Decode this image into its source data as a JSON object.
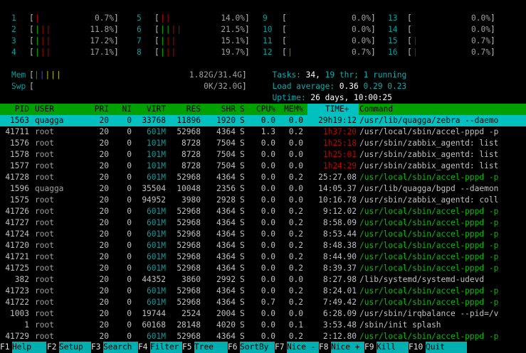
{
  "cpu_meters": [
    {
      "id": "1",
      "bar": "|",
      "pct": "0.7%"
    },
    {
      "id": "2",
      "bar": "|||",
      "pct": "11.8%"
    },
    {
      "id": "3",
      "bar": "|||",
      "pct": "17.2%"
    },
    {
      "id": "4",
      "bar": "|||",
      "pct": "17.1%"
    },
    {
      "id": "5",
      "bar": "||",
      "pct": "14.0%"
    },
    {
      "id": "6",
      "bar": "||||",
      "pct": "21.5%"
    },
    {
      "id": "7",
      "bar": "|||",
      "pct": "15.1%"
    },
    {
      "id": "8",
      "bar": "|||",
      "pct": "19.7%"
    },
    {
      "id": "9",
      "bar": "",
      "pct": "0.0%"
    },
    {
      "id": "10",
      "bar": "",
      "pct": "0.0%"
    },
    {
      "id": "11",
      "bar": "",
      "pct": "0.0%"
    },
    {
      "id": "12",
      "bar": "|",
      "pct": "0.7%"
    },
    {
      "id": "13",
      "bar": "",
      "pct": "0.0%"
    },
    {
      "id": "14",
      "bar": "",
      "pct": "0.0%"
    },
    {
      "id": "15",
      "bar": "|",
      "pct": "0.7%"
    },
    {
      "id": "16",
      "bar": "|",
      "pct": "0.7%"
    }
  ],
  "mem": {
    "label": "Mem",
    "bar": "|||||",
    "value": "1.82G/31.4G"
  },
  "swp": {
    "label": "Swp",
    "bar": "",
    "value": "0K/32.0G"
  },
  "tasks": {
    "label": "Tasks:",
    "count": "34,",
    "thr": "19",
    "thr_label": "thr;",
    "running": "1",
    "running_label": "running"
  },
  "load": {
    "label": "Load average:",
    "v1": "0.36",
    "v2": "0.29",
    "v3": "0.23"
  },
  "uptime": {
    "label": "Uptime:",
    "value": "26 days, 10:00:25"
  },
  "columns": {
    "pid": "PID",
    "user": "USER",
    "pri": "PRI",
    "ni": "NI",
    "virt": "VIRT",
    "res": "RES",
    "shr": "SHR",
    "s": "S",
    "cpu": "CPU%",
    "mem": "MEM%",
    "time": "TIME+",
    "command": "Command"
  },
  "processes": [
    {
      "pid": "1563",
      "user": "quagga",
      "pri": "20",
      "ni": "0",
      "virt": "33768",
      "res": "11896",
      "shr": "1920",
      "s": "S",
      "cpu": "0.0",
      "mem": "0.0",
      "time": "29h19:12",
      "command": "/usr/lib/quagga/zebra --daemo",
      "selected": true
    },
    {
      "pid": "41711",
      "user": "root",
      "pri": "20",
      "ni": "0",
      "virt": "601M",
      "res": "52968",
      "shr": "4364",
      "s": "S",
      "cpu": "1.3",
      "mem": "0.2",
      "time": "1h37:20",
      "command": "/usr/local/sbin/accel-pppd -p"
    },
    {
      "pid": "1576",
      "user": "root",
      "pri": "20",
      "ni": "0",
      "virt": "101M",
      "res": "8728",
      "shr": "7504",
      "s": "S",
      "cpu": "0.0",
      "mem": "0.0",
      "time": "1h25:18",
      "command": "/usr/sbin/zabbix_agentd: list"
    },
    {
      "pid": "1578",
      "user": "root",
      "pri": "20",
      "ni": "0",
      "virt": "101M",
      "res": "8728",
      "shr": "7504",
      "s": "S",
      "cpu": "0.0",
      "mem": "0.0",
      "time": "1h25:01",
      "command": "/usr/sbin/zabbix_agentd: list"
    },
    {
      "pid": "1577",
      "user": "root",
      "pri": "20",
      "ni": "0",
      "virt": "101M",
      "res": "8728",
      "shr": "7504",
      "s": "S",
      "cpu": "0.0",
      "mem": "0.0",
      "time": "1h24:29",
      "command": "/usr/sbin/zabbix_agentd: list"
    },
    {
      "pid": "41728",
      "user": "root",
      "pri": "20",
      "ni": "0",
      "virt": "601M",
      "res": "52968",
      "shr": "4364",
      "s": "S",
      "cpu": "0.0",
      "mem": "0.2",
      "time": "25:27.08",
      "command": "/usr/local/sbin/accel-pppd -p",
      "green": true
    },
    {
      "pid": "1596",
      "user": "quagga",
      "pri": "20",
      "ni": "0",
      "virt": "35504",
      "res": "10048",
      "shr": "2356",
      "s": "S",
      "cpu": "0.0",
      "mem": "0.0",
      "time": "14:05.37",
      "command": "/usr/lib/quagga/bgpd --daemon"
    },
    {
      "pid": "1575",
      "user": "root",
      "pri": "20",
      "ni": "0",
      "virt": "94952",
      "res": "3980",
      "shr": "2928",
      "s": "S",
      "cpu": "0.0",
      "mem": "0.0",
      "time": "10:16.78",
      "command": "/usr/sbin/zabbix_agentd: coll"
    },
    {
      "pid": "41726",
      "user": "root",
      "pri": "20",
      "ni": "0",
      "virt": "601M",
      "res": "52968",
      "shr": "4364",
      "s": "S",
      "cpu": "0.0",
      "mem": "0.2",
      "time": "9:12.02",
      "command": "/usr/local/sbin/accel-pppd -p",
      "green": true
    },
    {
      "pid": "41727",
      "user": "root",
      "pri": "20",
      "ni": "0",
      "virt": "601M",
      "res": "52968",
      "shr": "4364",
      "s": "S",
      "cpu": "0.0",
      "mem": "0.2",
      "time": "8:58.09",
      "command": "/usr/local/sbin/accel-pppd -p",
      "green": true
    },
    {
      "pid": "41724",
      "user": "root",
      "pri": "20",
      "ni": "0",
      "virt": "601M",
      "res": "52968",
      "shr": "4364",
      "s": "S",
      "cpu": "0.0",
      "mem": "0.2",
      "time": "8:53.44",
      "command": "/usr/local/sbin/accel-pppd -p",
      "green": true
    },
    {
      "pid": "41720",
      "user": "root",
      "pri": "20",
      "ni": "0",
      "virt": "601M",
      "res": "52968",
      "shr": "4364",
      "s": "S",
      "cpu": "0.0",
      "mem": "0.2",
      "time": "8:48.38",
      "command": "/usr/local/sbin/accel-pppd -p",
      "green": true
    },
    {
      "pid": "41721",
      "user": "root",
      "pri": "20",
      "ni": "0",
      "virt": "601M",
      "res": "52968",
      "shr": "4364",
      "s": "S",
      "cpu": "0.0",
      "mem": "0.2",
      "time": "8:44.90",
      "command": "/usr/local/sbin/accel-pppd -p",
      "green": true
    },
    {
      "pid": "41725",
      "user": "root",
      "pri": "20",
      "ni": "0",
      "virt": "601M",
      "res": "52968",
      "shr": "4364",
      "s": "S",
      "cpu": "0.0",
      "mem": "0.2",
      "time": "8:39.37",
      "command": "/usr/local/sbin/accel-pppd -p",
      "green": true
    },
    {
      "pid": "382",
      "user": "root",
      "pri": "20",
      "ni": "0",
      "virt": "44352",
      "res": "3860",
      "shr": "2992",
      "s": "S",
      "cpu": "0.0",
      "mem": "0.0",
      "time": "8:27.98",
      "command": "/lib/systemd/systemd-udevd"
    },
    {
      "pid": "41723",
      "user": "root",
      "pri": "20",
      "ni": "0",
      "virt": "601M",
      "res": "52968",
      "shr": "4364",
      "s": "S",
      "cpu": "0.0",
      "mem": "0.2",
      "time": "8:24.01",
      "command": "/usr/local/sbin/accel-pppd -p",
      "green": true
    },
    {
      "pid": "41722",
      "user": "root",
      "pri": "20",
      "ni": "0",
      "virt": "601M",
      "res": "52968",
      "shr": "4364",
      "s": "S",
      "cpu": "0.7",
      "mem": "0.2",
      "time": "7:49.42",
      "command": "/usr/local/sbin/accel-pppd -p",
      "green": true
    },
    {
      "pid": "1003",
      "user": "root",
      "pri": "20",
      "ni": "0",
      "virt": "19744",
      "res": "2524",
      "shr": "2004",
      "s": "S",
      "cpu": "0.0",
      "mem": "0.0",
      "time": "6:28.09",
      "command": "/usr/sbin/irqbalance --pid=/v"
    },
    {
      "pid": "1",
      "user": "root",
      "pri": "20",
      "ni": "0",
      "virt": "60168",
      "res": "28148",
      "shr": "4020",
      "s": "S",
      "cpu": "0.0",
      "mem": "0.1",
      "time": "3:53.48",
      "command": "/sbin/init splash"
    },
    {
      "pid": "41729",
      "user": "root",
      "pri": "20",
      "ni": "0",
      "virt": "601M",
      "res": "52968",
      "shr": "4364",
      "s": "S",
      "cpu": "0.0",
      "mem": "0.2",
      "time": "2:12.80",
      "command": "/usr/local/sbin/accel-pppd -p",
      "green": true
    }
  ],
  "footer": [
    {
      "key": "F1",
      "label": "Help"
    },
    {
      "key": "F2",
      "label": "Setup"
    },
    {
      "key": "F3",
      "label": "Search"
    },
    {
      "key": "F4",
      "label": "Filter"
    },
    {
      "key": "F5",
      "label": "Tree"
    },
    {
      "key": "F6",
      "label": "SortBy"
    },
    {
      "key": "F7",
      "label": "Nice -"
    },
    {
      "key": "F8",
      "label": "Nice +"
    },
    {
      "key": "F9",
      "label": "Kill"
    },
    {
      "key": "F10",
      "label": "Quit"
    }
  ]
}
